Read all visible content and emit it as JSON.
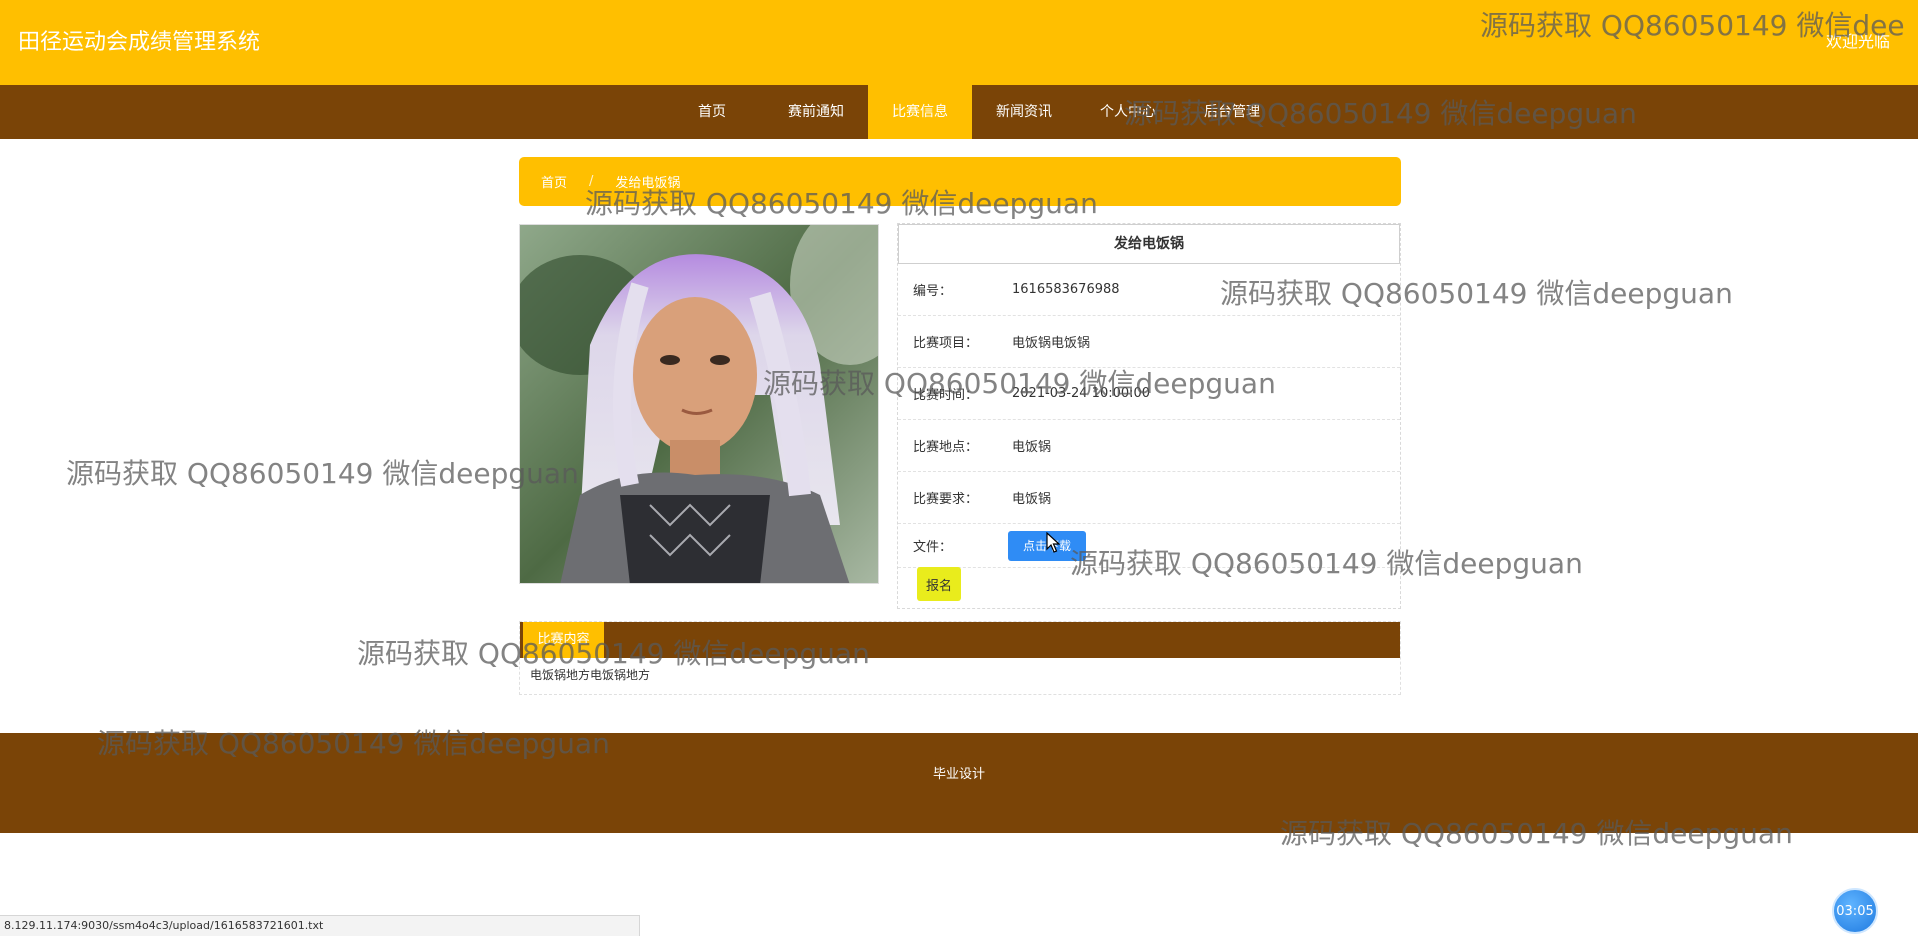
{
  "header": {
    "site_title": "田径运动会成绩管理系统",
    "welcome": "欢迎光临"
  },
  "nav": {
    "items": [
      {
        "label": "首页"
      },
      {
        "label": "赛前通知"
      },
      {
        "label": "比赛信息",
        "active": true
      },
      {
        "label": "新闻资讯"
      },
      {
        "label": "个人中心"
      },
      {
        "label": "后台管理"
      }
    ]
  },
  "breadcrumb": {
    "home": "首页",
    "separator": "/",
    "current": "发给电饭锅"
  },
  "photo": {
    "icon": "portrait-image"
  },
  "detail": {
    "title": "发给电饭锅",
    "fields": [
      {
        "key": "编号：",
        "value": "1616583676988"
      },
      {
        "key": "比赛项目：",
        "value": "电饭锅电饭锅"
      },
      {
        "key": "比赛时间：",
        "value": "2021-03-24 10:00:00"
      },
      {
        "key": "比赛地点：",
        "value": "电饭锅"
      },
      {
        "key": "比赛要求：",
        "value": "电饭锅"
      }
    ],
    "file_label": "文件：",
    "download_label": "点击下载",
    "signup_label": "报名"
  },
  "intro": {
    "tab_label": "比赛内容",
    "text": "电饭锅地方电饭锅地方"
  },
  "footer": {
    "text": "毕业设计"
  },
  "status": {
    "url": "8.129.11.174:9030/ssm4o4c3/upload/1616583721601.txt",
    "timer": "03:05"
  },
  "watermark": {
    "text": "源码获取 QQ86050149 微信deepguan",
    "text_clipped": "源码获取 QQ86050149 微信dee"
  },
  "colors": {
    "gold": "#ffbf00",
    "brown": "#7a4407",
    "blue": "#2f8cf5",
    "yellow_button": "#e9ec1c"
  }
}
